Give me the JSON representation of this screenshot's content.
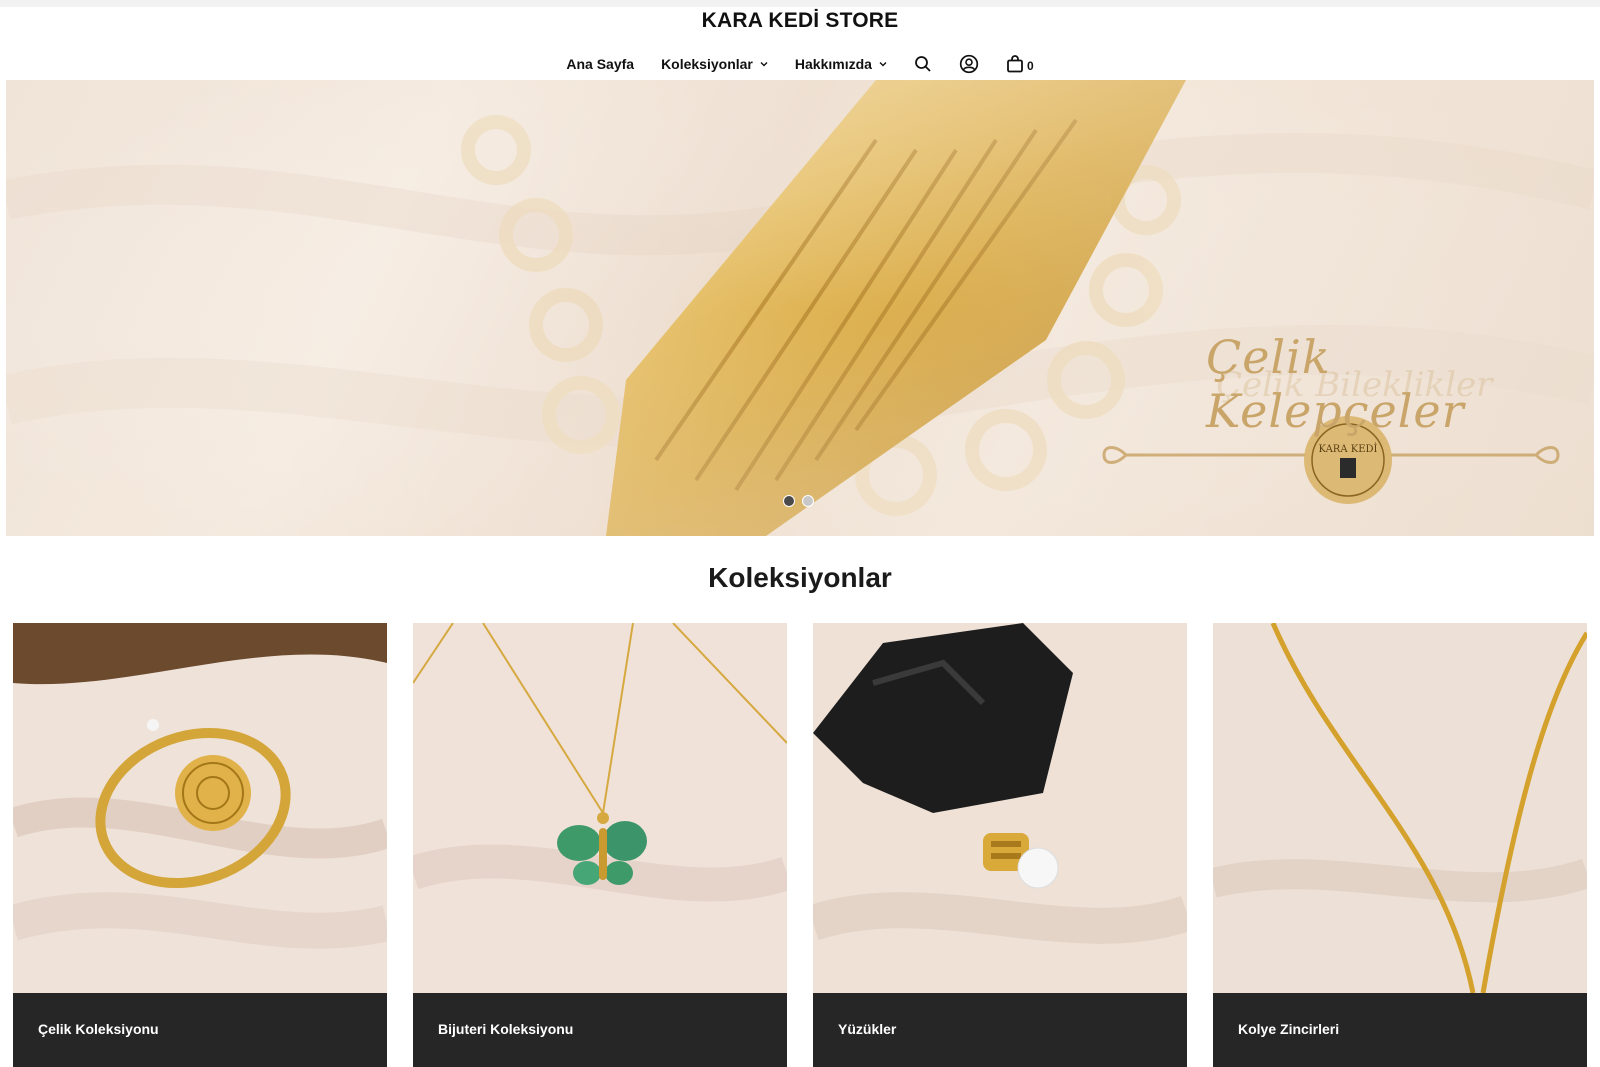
{
  "header": {
    "brand": "KARA KEDİ STORE",
    "nav": [
      {
        "label": "Ana Sayfa",
        "has_dropdown": false
      },
      {
        "label": "Koleksiyonlar",
        "has_dropdown": true
      },
      {
        "label": "Hakkımızda",
        "has_dropdown": true
      }
    ],
    "icons": [
      "search-icon",
      "account-icon",
      "cart-icon"
    ],
    "cart_count": "0"
  },
  "hero": {
    "script_text": "Çelik Kelepçeler",
    "ghost_text": "Çelik Bileklikler",
    "logo_text": "KARA KEDİ",
    "slides_total": 2,
    "active_slide": 1
  },
  "collections": {
    "title": "Koleksiyonlar",
    "items": [
      {
        "label": "Çelik Koleksiyonu",
        "image": "gold bangle bracelet"
      },
      {
        "label": "Bijuteri Koleksiyonu",
        "image": "green butterfly necklace"
      },
      {
        "label": "Yüzükler",
        "image": "gold ring with size tag"
      },
      {
        "label": "Kolye Zincirleri",
        "image": "gold chain necklace"
      }
    ]
  },
  "colors": {
    "accent_gold": "#d4a63a",
    "label_bar": "#262626",
    "text": "#111111"
  }
}
